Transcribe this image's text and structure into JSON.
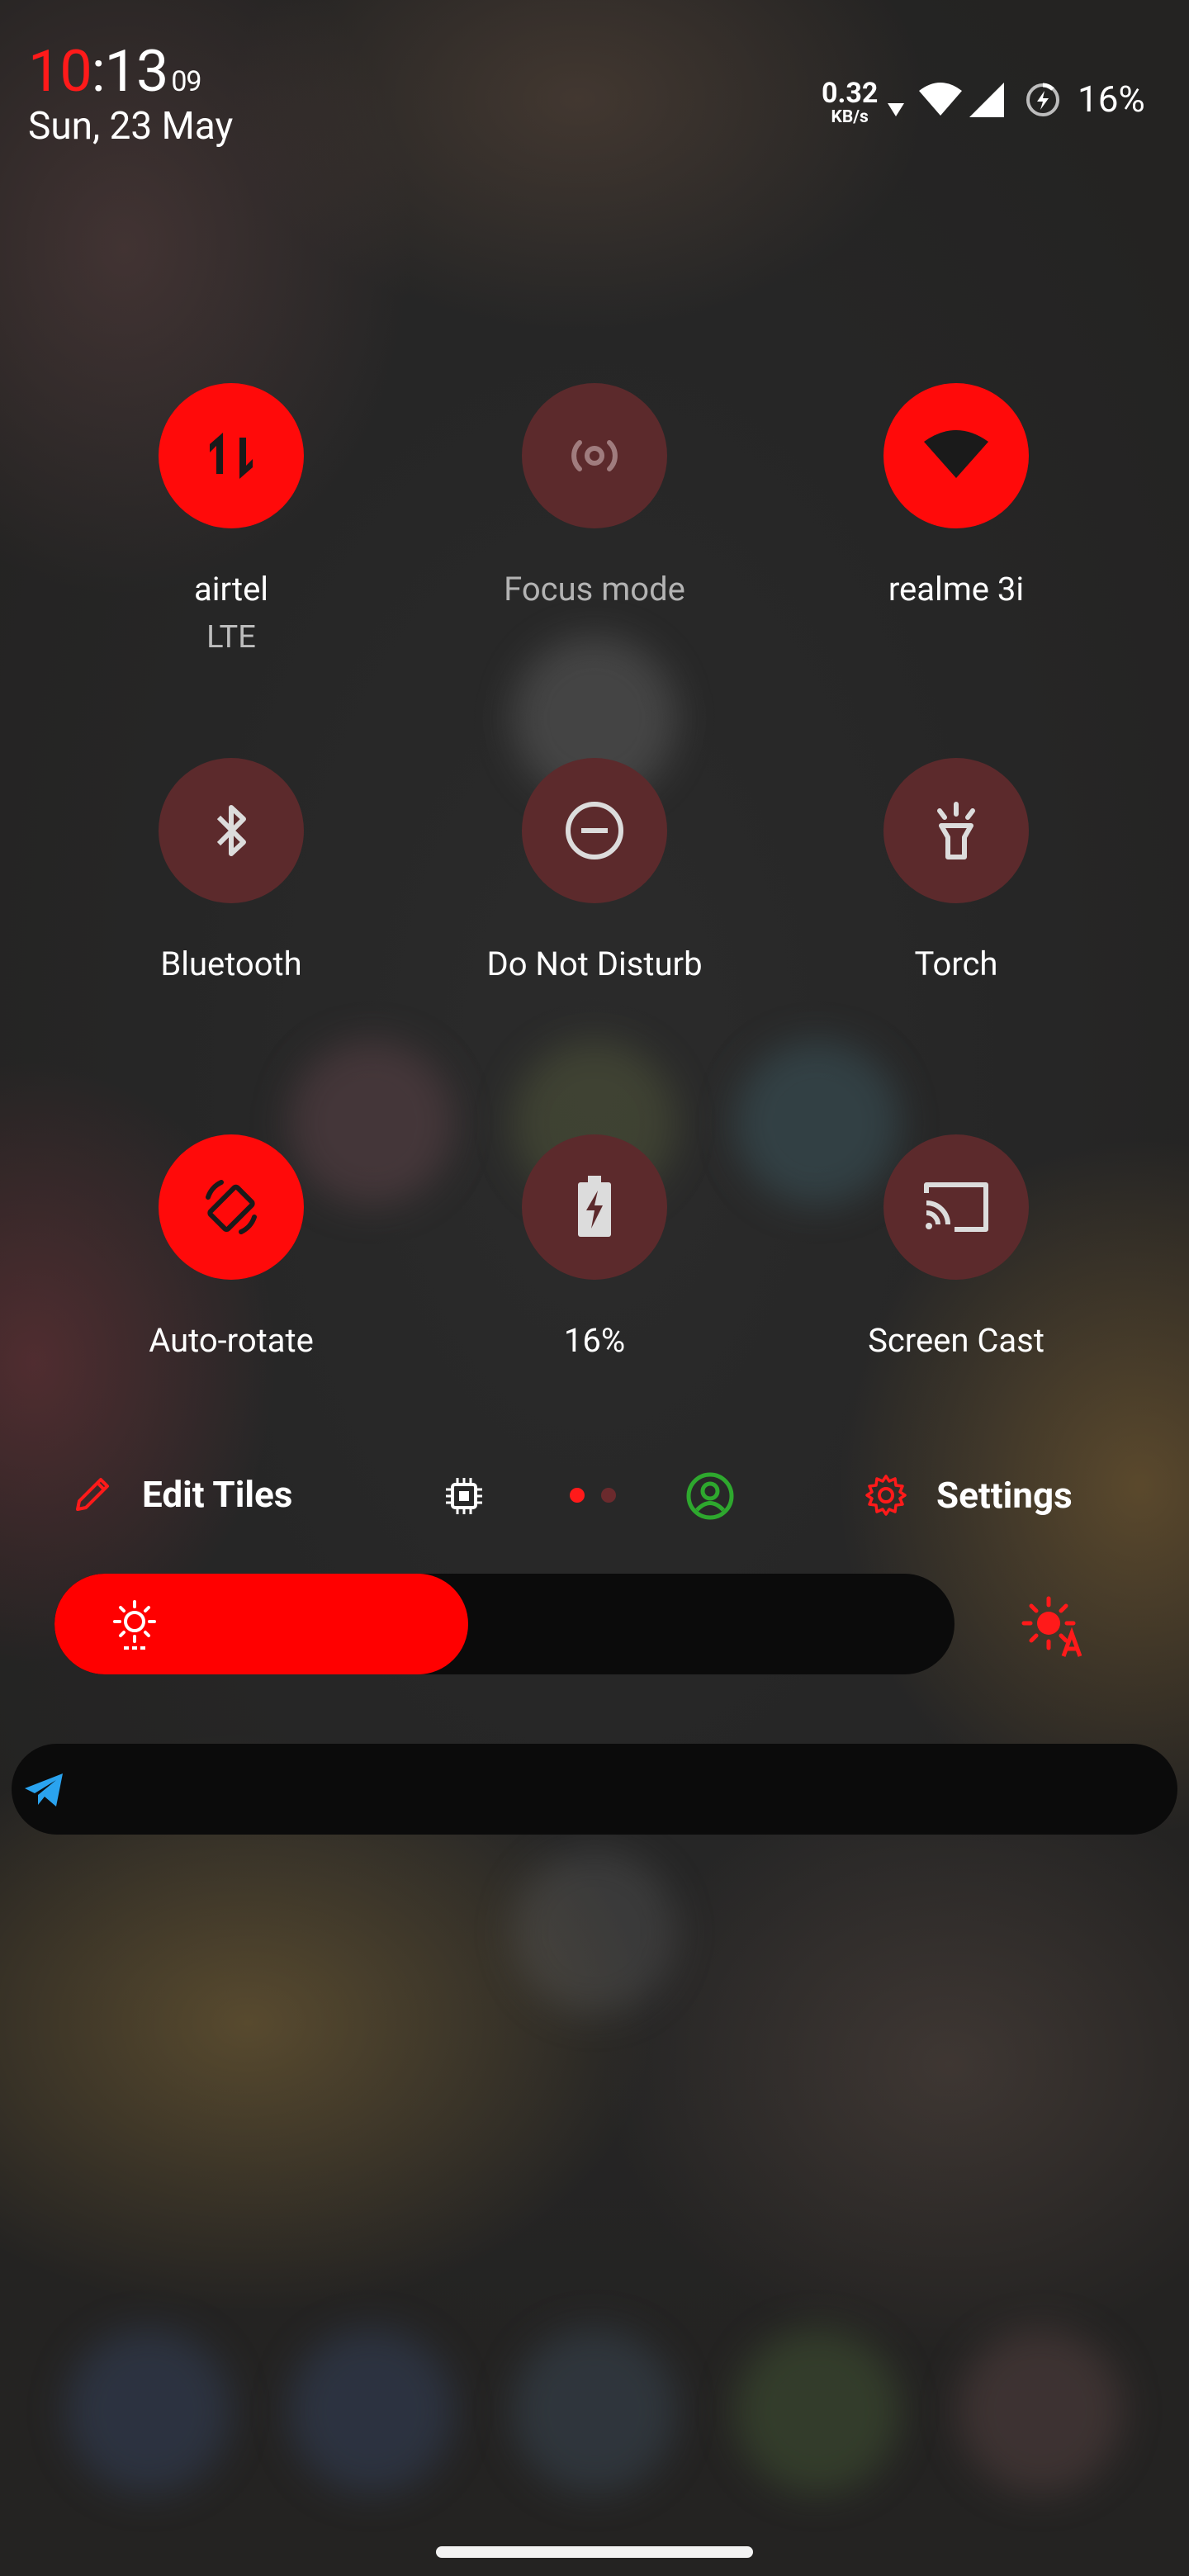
{
  "status_bar": {
    "time_hours": "10",
    "time_minutes": "13",
    "time_seconds": "09",
    "date": "Sun, 23 May",
    "net_speed_value": "0.32",
    "net_speed_unit": "KB/s",
    "battery_percent": "16%",
    "icons": [
      "download-arrow-icon",
      "wifi-icon",
      "cell-signal-icon",
      "battery-charging-icon"
    ]
  },
  "tiles": [
    {
      "label": "airtel",
      "sub": "LTE",
      "icon": "mobile-data-icon",
      "state": "on"
    },
    {
      "label": "Focus mode",
      "sub": "",
      "icon": "focus-mode-icon",
      "state": "off"
    },
    {
      "label": "realme 3i",
      "sub": "",
      "icon": "wifi-icon",
      "state": "on"
    },
    {
      "label": "Bluetooth",
      "sub": "",
      "icon": "bluetooth-icon",
      "state": "off"
    },
    {
      "label": "Do Not Disturb",
      "sub": "",
      "icon": "do-not-disturb-icon",
      "state": "off"
    },
    {
      "label": "Torch",
      "sub": "",
      "icon": "torch-icon",
      "state": "off"
    },
    {
      "label": "Auto-rotate",
      "sub": "",
      "icon": "auto-rotate-icon",
      "state": "on"
    },
    {
      "label": "16%",
      "sub": "",
      "icon": "battery-saver-icon",
      "state": "off"
    },
    {
      "label": "Screen Cast",
      "sub": "",
      "icon": "screen-cast-icon",
      "state": "off"
    }
  ],
  "footer": {
    "edit_label": "Edit Tiles",
    "settings_label": "Settings",
    "page_indicator": {
      "pages": 2,
      "current": 1
    }
  },
  "brightness": {
    "level": 0.46
  },
  "colors": {
    "accent": "#ff0000",
    "tile_off": "#5c2a2c",
    "user_icon": "#2ea82e",
    "telegram": "#2aa3ef"
  }
}
